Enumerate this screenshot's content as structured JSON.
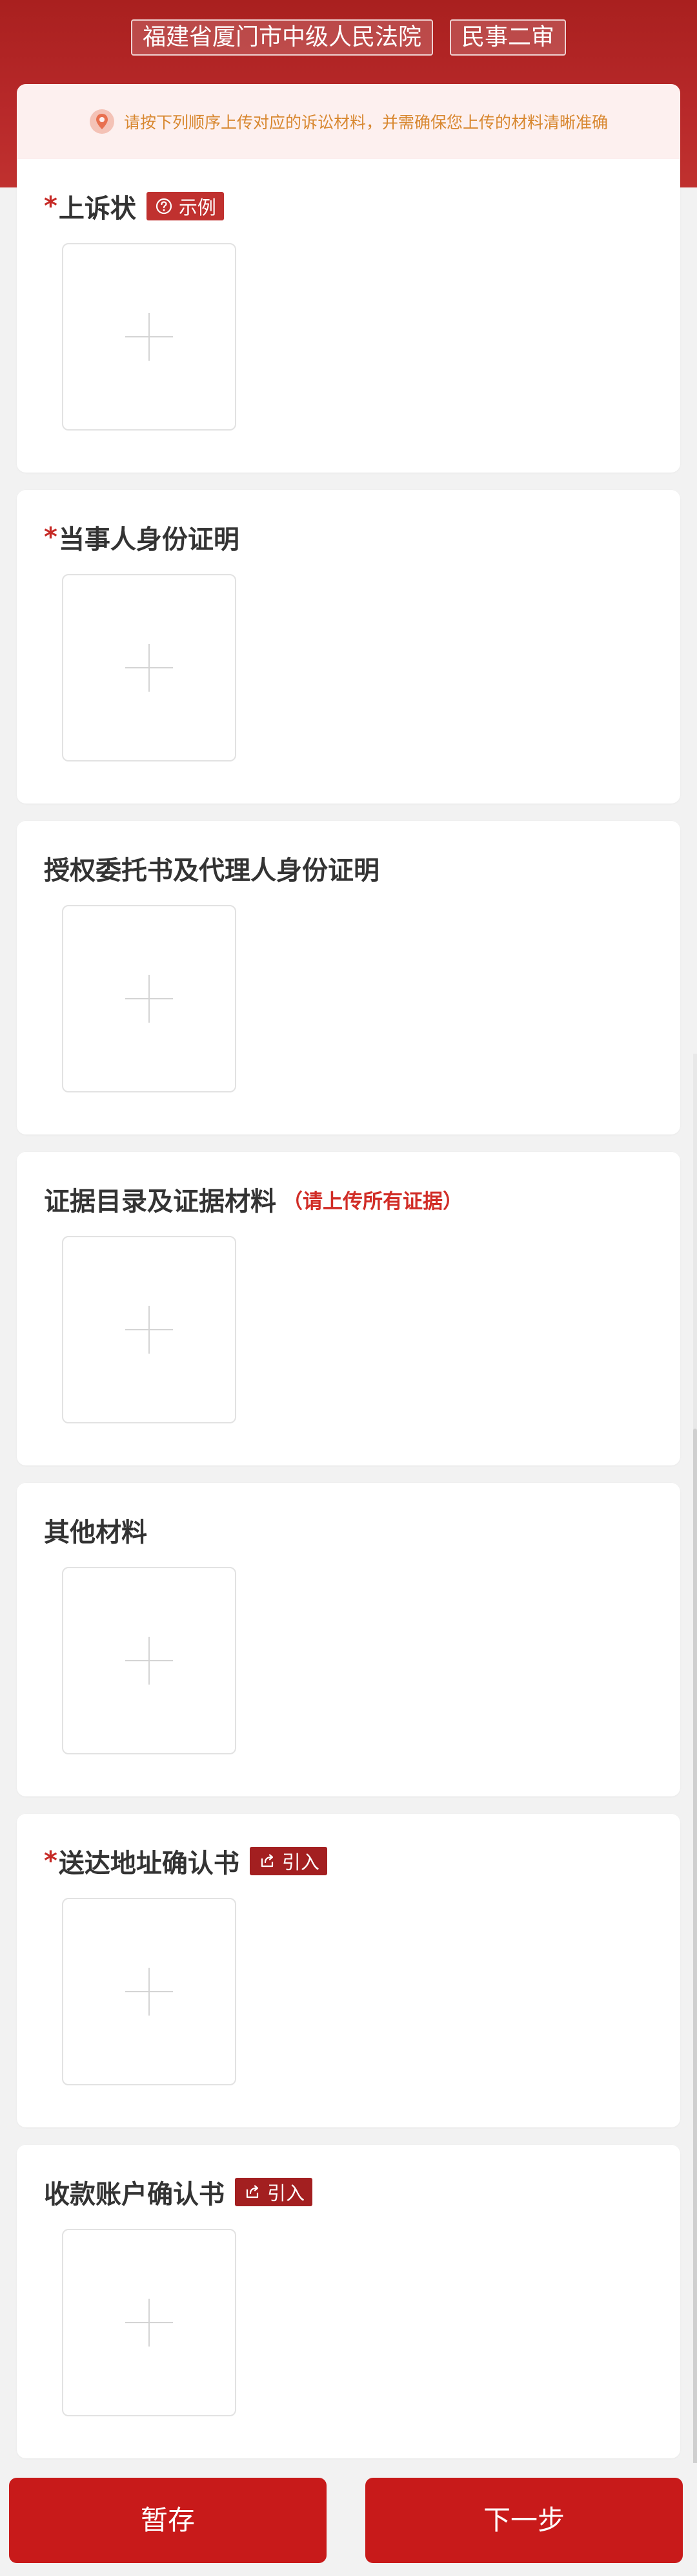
{
  "header": {
    "court": "福建省厦门市中级人民法院",
    "case_type": "民事二审",
    "notice": "请按下列顺序上传对应的诉讼材料，并需确保您上传的材料清晰准确"
  },
  "sections": [
    {
      "title": "上诉状",
      "required": "*",
      "badge": "示例"
    },
    {
      "title": "当事人身份证明",
      "required": "*"
    },
    {
      "title": "授权委托书及代理人身份证明"
    },
    {
      "title": "证据目录及证据材料",
      "hint": "（请上传所有证据）"
    },
    {
      "title": "其他材料"
    },
    {
      "title": "送达地址确认书",
      "required": "*",
      "badge": "引入"
    },
    {
      "title": "收款账户确认书",
      "badge": "引入"
    }
  ],
  "footer": {
    "save_label": "暂存",
    "next_label": "下一步"
  },
  "colors": {
    "brand_red": "#c81a1a",
    "header_red": "#b8292a",
    "notice_text": "#d8872f"
  }
}
